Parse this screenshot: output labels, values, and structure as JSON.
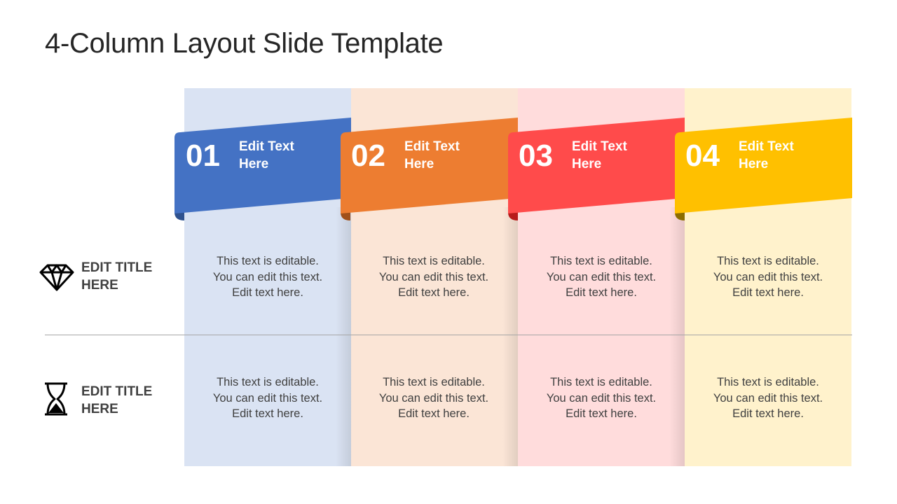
{
  "slide": {
    "title": "4-Column Layout Slide Template"
  },
  "columns": [
    {
      "number": "01",
      "heading": "Edit Text Here",
      "ribbon_color": "#4472C4",
      "ribbon_fold_color": "#2F528F",
      "bg_color": "#DAE3F3"
    },
    {
      "number": "02",
      "heading": "Edit Text Here",
      "ribbon_color": "#ED7D31",
      "ribbon_fold_color": "#A0501A",
      "bg_color": "#FBE5D6"
    },
    {
      "number": "03",
      "heading": "Edit Text Here",
      "ribbon_color": "#FF4B4B",
      "ribbon_fold_color": "#B81B1B",
      "bg_color": "#FFDCDC"
    },
    {
      "number": "04",
      "heading": "Edit Text Here",
      "ribbon_color": "#FFC000",
      "ribbon_fold_color": "#8C6D00",
      "bg_color": "#FFF2CC"
    }
  ],
  "rows": [
    {
      "icon": "diamond-icon",
      "label": "EDIT TITLE HERE",
      "cells": [
        "This text is editable. You can edit this text. Edit text here.",
        "This text is editable. You can edit this text. Edit text here.",
        "This text is editable. You can edit this text. Edit text here.",
        "This text is editable. You can edit this text. Edit text here."
      ]
    },
    {
      "icon": "hourglass-icon",
      "label": "EDIT TITLE HERE",
      "cells": [
        "This text is editable. You can edit this text. Edit text here.",
        "This text is editable. You can edit this text. Edit text here.",
        "This text is editable. You can edit this text. Edit text here.",
        "This text is editable. You can edit this text. Edit text here."
      ]
    }
  ],
  "cell_lines": [
    "This text is editable.",
    "You can edit this text.",
    "Edit text here."
  ],
  "heading_lines": [
    "Edit Text",
    "Here"
  ],
  "row_label_lines": [
    "EDIT TITLE",
    "HERE"
  ]
}
